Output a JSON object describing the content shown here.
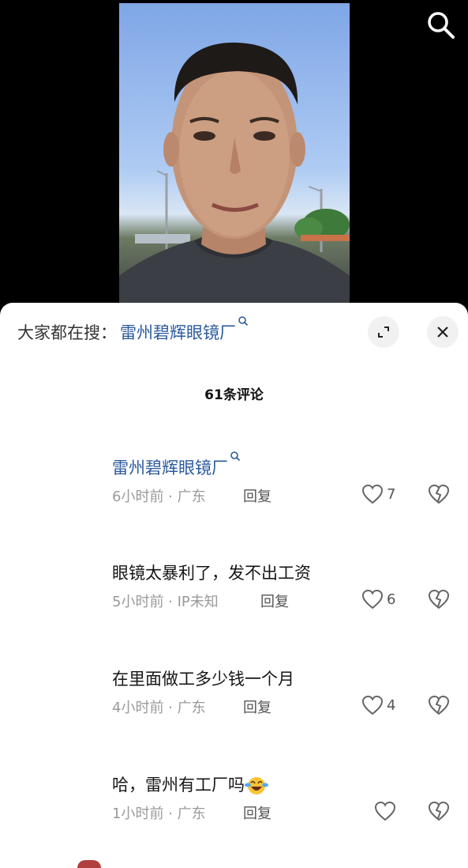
{
  "hot_search": {
    "prefix": "大家都在搜：",
    "keyword": "雷州碧辉眼镜厂"
  },
  "comments_count": "61条评论",
  "comments": [
    {
      "text": "雷州碧辉眼镜厂",
      "is_link": true,
      "meta": "6小时前 · 广东",
      "reply": "回复",
      "likes": "7"
    },
    {
      "text": "眼镜太暴利了，发不出工资",
      "is_link": false,
      "meta": "5小时前 · IP未知",
      "reply": "回复",
      "likes": "6"
    },
    {
      "text": "在里面做工多少钱一个月",
      "is_link": false,
      "meta": "4小时前 · 广东",
      "reply": "回复",
      "likes": "4"
    },
    {
      "text": "哈，雷州有工厂吗",
      "is_link": false,
      "meta": "1小时前 · 广东",
      "reply": "回复",
      "likes": ""
    }
  ],
  "colors": {
    "link": "#2b5a9e",
    "sheet_bg": "#ffffff",
    "meta": "#9a9a9a"
  },
  "icons": [
    "search-icon",
    "expand-icon",
    "close-icon",
    "heart-icon",
    "broken-heart-icon",
    "laughing-crying-emoji"
  ]
}
